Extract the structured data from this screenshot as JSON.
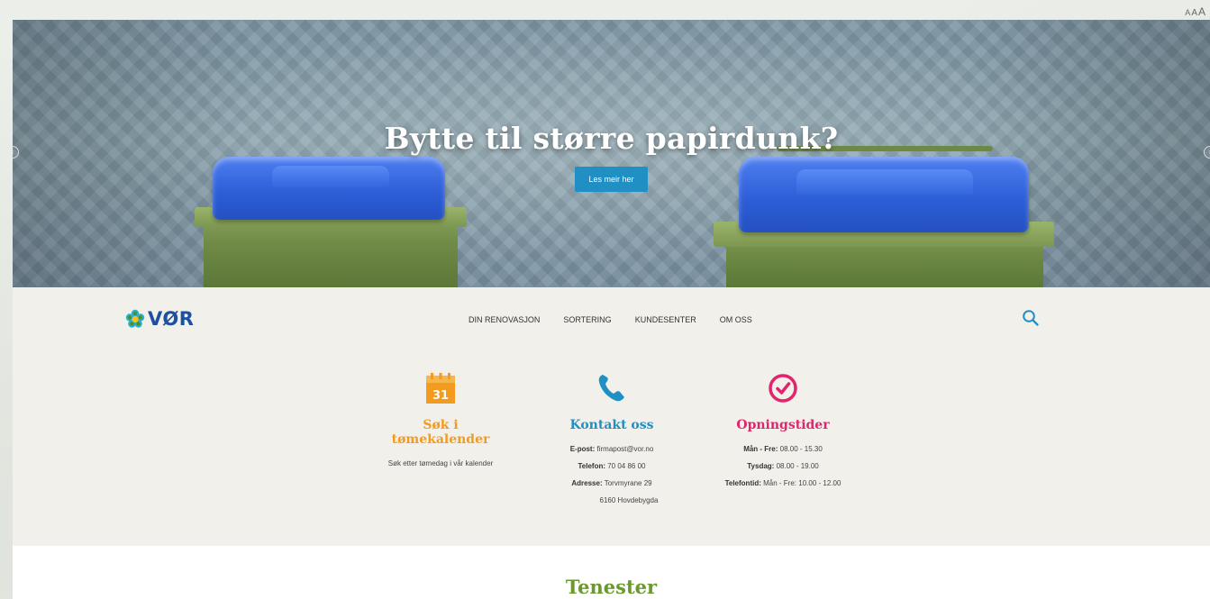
{
  "font_size_control": [
    "A",
    "A",
    "A"
  ],
  "hero": {
    "title": "Bytte til større papirdunk?",
    "button_label": "Les meir her",
    "prev_arrow": "‹",
    "next_arrow": "›"
  },
  "nav": {
    "logo_text": "VØR",
    "menu": [
      "DIN RENOVASJON",
      "SORTERING",
      "KUNDESENTER",
      "OM OSS"
    ]
  },
  "info": {
    "calendar": {
      "icon_number": "31",
      "title": "Søk i tømekalender",
      "text": "Søk etter tømedag i vår kalender"
    },
    "contact": {
      "title": "Kontakt oss",
      "email_label": "E-post:",
      "email": "firmapost@vor.no",
      "phone_label": "Telefon:",
      "phone": "70 04 86 00",
      "address_label": "Adresse:",
      "address_line1": "Torvmyrane 29",
      "address_line2": "6160 Hovdebygda"
    },
    "hours": {
      "title": "Opningstider",
      "weekday_label": "Mån - Fre:",
      "weekday": "08.00 - 15.30",
      "tuesday_label": "Tysdag:",
      "tuesday": "08.00 - 19.00",
      "phone_time_label": "Telefontid:",
      "phone_time": "Mån - Fre: 10.00 - 12.00"
    }
  },
  "services": {
    "title": "Tenester"
  },
  "colors": {
    "calendar_accent": "#f29b1e",
    "contact_accent": "#1f8fc4",
    "hours_accent": "#e0256e",
    "services_green": "#6a9a2e",
    "logo_blue": "#1e4fa0"
  }
}
